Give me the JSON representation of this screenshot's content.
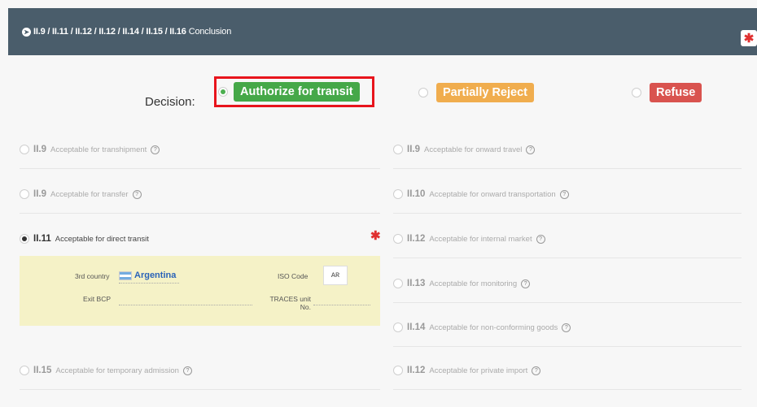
{
  "header": {
    "codes": "II.9 / II.11 / II.12 / II.12 / II.14 / II.15 / II.16",
    "title": "Conclusion",
    "arrow_icon": "circle-arrow-right-icon",
    "required_icon": "asterisk-icon"
  },
  "decision": {
    "label": "Decision:",
    "options": [
      {
        "label": "Authorize for transit",
        "selected": true,
        "color": "#45a848"
      },
      {
        "label": "Partially Reject",
        "selected": false,
        "color": "#f0ad4e"
      },
      {
        "label": "Refuse",
        "selected": false,
        "color": "#d9534f"
      }
    ]
  },
  "left_options": [
    {
      "code": "II.9",
      "label": "Acceptable for transhipment",
      "selected": false
    },
    {
      "code": "II.9",
      "label": "Acceptable for transfer",
      "selected": false
    },
    {
      "code": "II.11",
      "label": "Acceptable for direct transit",
      "selected": true
    },
    {
      "code": "II.15",
      "label": "Acceptable for temporary admission",
      "selected": false
    }
  ],
  "right_options": [
    {
      "code": "II.9",
      "label": "Acceptable for onward travel",
      "selected": false
    },
    {
      "code": "II.10",
      "label": "Acceptable for onward transportation",
      "selected": false
    },
    {
      "code": "II.12",
      "label": "Acceptable for internal market",
      "selected": false
    },
    {
      "code": "II.13",
      "label": "Acceptable for monitoring",
      "selected": false
    },
    {
      "code": "II.14",
      "label": "Acceptable for non-conforming goods",
      "selected": false
    },
    {
      "code": "II.12",
      "label": "Acceptable for private import",
      "selected": false
    }
  ],
  "transit_details": {
    "third_country_label": "3rd country",
    "third_country_value": "Argentina",
    "iso_label": "ISO Code",
    "iso_value": "AR",
    "exit_bcp_label": "Exit BCP",
    "traces_label": "TRACES unit",
    "traces_label2": "No."
  },
  "colors": {
    "header_bg": "#4a5d6b",
    "highlight": "#e8141c",
    "panel_yellow": "#f5f2c7"
  }
}
